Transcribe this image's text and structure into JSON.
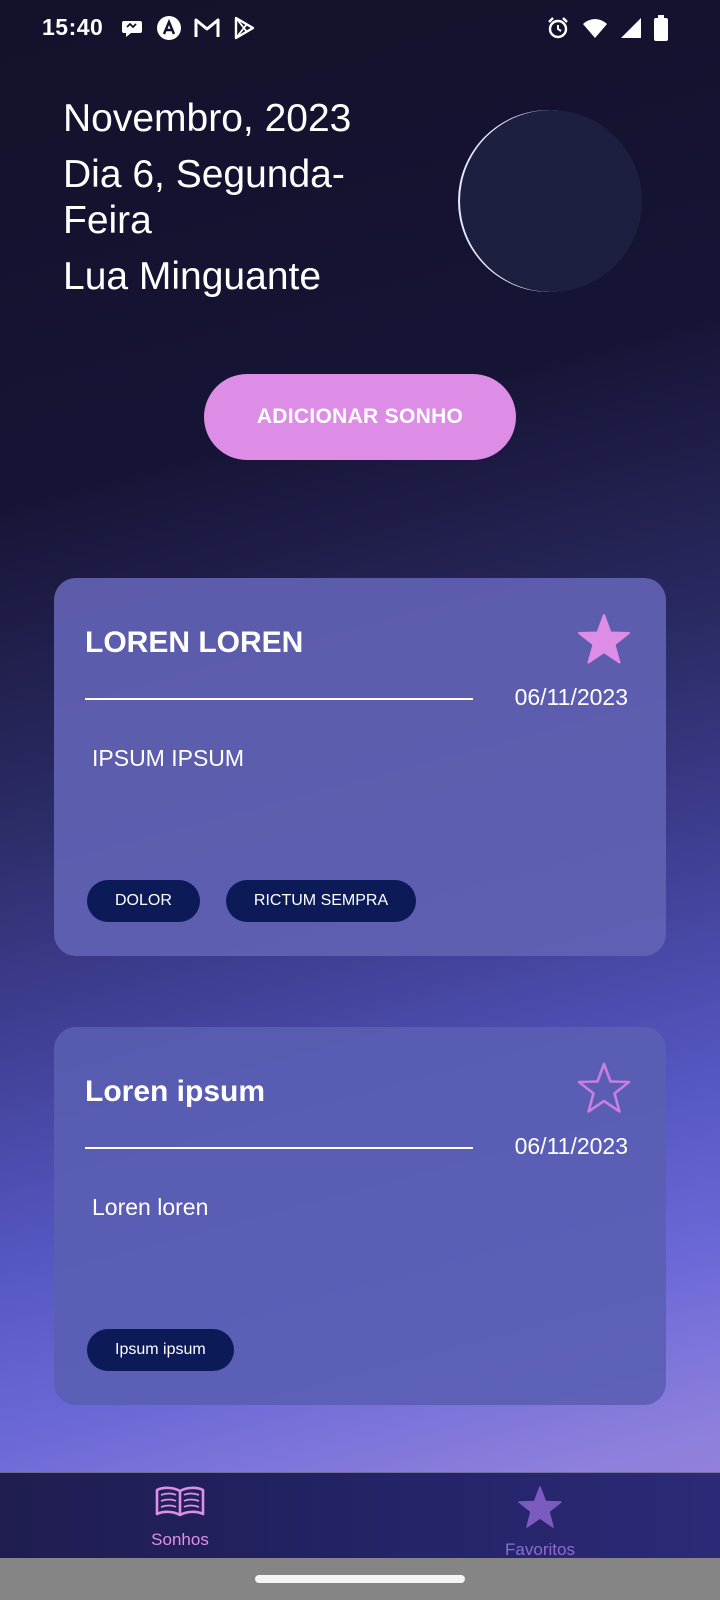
{
  "status_bar": {
    "time": "15:40",
    "notification_icons": [
      "chat-bubble-icon",
      "app-a-icon",
      "gmail-icon",
      "play-icon"
    ],
    "system_icons": [
      "alarm-icon",
      "wifi-icon",
      "signal-icon",
      "battery-icon"
    ]
  },
  "header": {
    "month_year": "Novembro, 2023",
    "day": "Dia 6, Segunda-Feira",
    "moon_phase": "Lua Minguante"
  },
  "add_button": {
    "label": "ADICIONAR SONHO"
  },
  "dreams": [
    {
      "title": "LOREN LOREN",
      "date": "06/11/2023",
      "body": "IPSUM IPSUM",
      "favorite": true,
      "tags": [
        "DOLOR",
        "RICTUM SEMPRA"
      ]
    },
    {
      "title": "Loren ipsum",
      "date": "06/11/2023",
      "body": "Loren loren",
      "favorite": false,
      "tags": [
        "Ipsum ipsum"
      ]
    }
  ],
  "bottom_nav": {
    "items": [
      {
        "label": "Sonhos",
        "icon": "book-icon",
        "active": true
      },
      {
        "label": "Favoritos",
        "icon": "star-icon",
        "active": false
      }
    ]
  },
  "colors": {
    "accent": "#dd8de6",
    "tag_background": "#0c1a58",
    "card_background": "#6262b4",
    "favorite_inactive": "#8c6ec8"
  }
}
